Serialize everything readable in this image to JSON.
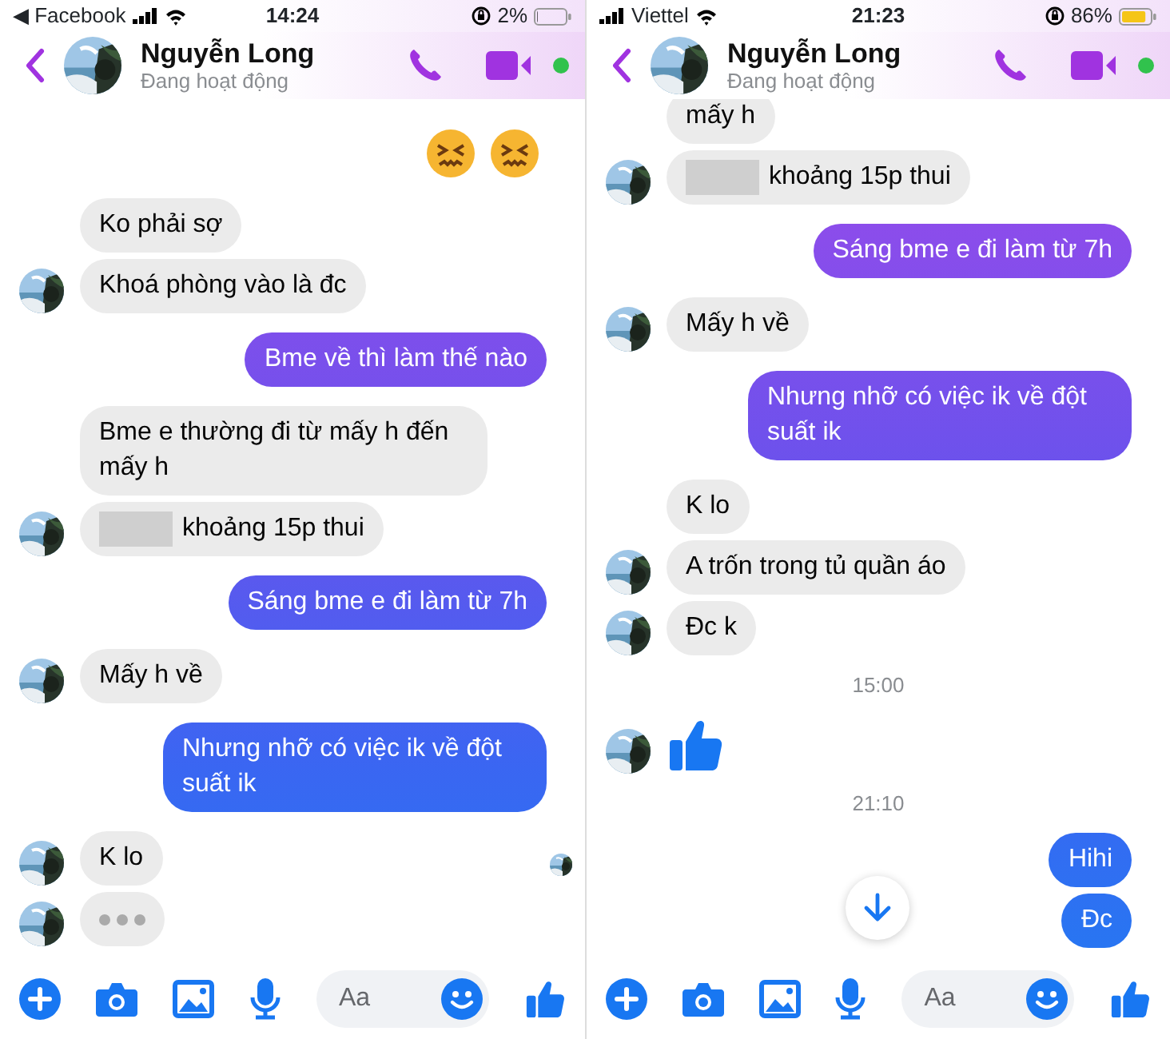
{
  "screens": [
    {
      "status_bar": {
        "back_link": "◀ Facebook",
        "time": "14:24",
        "battery": "2%",
        "low_power_mode": false
      },
      "header": {
        "name": "Nguyễn Long",
        "status": "Đang hoạt động",
        "online": true
      },
      "messages": [
        {
          "kind": "emojis"
        },
        {
          "kind": "received",
          "text": "Ko phải sợ",
          "avatar": false
        },
        {
          "kind": "received",
          "text": "Khoá phòng vào là đc",
          "avatar": true
        },
        {
          "kind": "sent",
          "text": "Bme về thì làm thế nào"
        },
        {
          "kind": "received",
          "text": "Bme e thường đi từ mấy h đến mấy h",
          "avatar": false
        },
        {
          "kind": "received",
          "text": "khoảng 15p thui",
          "avatar": true,
          "redacted": true
        },
        {
          "kind": "sent",
          "text": "Sáng bme e đi làm từ 7h"
        },
        {
          "kind": "received",
          "text": "Mấy h về",
          "avatar": true
        },
        {
          "kind": "sent",
          "text": "Nhưng nhỡ có việc ik về đột suất ik"
        },
        {
          "kind": "received",
          "text": "K lo",
          "avatar": true,
          "seen": true
        },
        {
          "kind": "typing",
          "avatar": true
        }
      ],
      "composer": {
        "placeholder": "Aa"
      }
    },
    {
      "status_bar": {
        "carrier": "Viettel",
        "time": "21:23",
        "battery": "86%",
        "low_power_mode": true
      },
      "header": {
        "name": "Nguyễn Long",
        "status": "Đang hoạt động",
        "online": true
      },
      "messages": [
        {
          "kind": "received",
          "text": "mấy h",
          "avatar": false
        },
        {
          "kind": "received",
          "text": "khoảng 15p thui",
          "avatar": true,
          "redacted": true
        },
        {
          "kind": "sent",
          "text": "Sáng bme e đi làm từ 7h"
        },
        {
          "kind": "received",
          "text": "Mấy h về",
          "avatar": true
        },
        {
          "kind": "sent",
          "text": "Nhưng nhỡ có việc ik về đột suất ik"
        },
        {
          "kind": "received",
          "text": "K lo",
          "avatar": false
        },
        {
          "kind": "received",
          "text": "A trốn trong tủ quần áo",
          "avatar": true
        },
        {
          "kind": "received",
          "text": "Đc k",
          "avatar": true
        },
        {
          "kind": "time",
          "text": "15:00"
        },
        {
          "kind": "like",
          "avatar": true
        },
        {
          "kind": "time",
          "text": "21:10"
        },
        {
          "kind": "sent",
          "text": "Hihi"
        },
        {
          "kind": "sent",
          "text": "Đc"
        }
      ],
      "scroll_down_button": true,
      "composer": {
        "placeholder": "Aa"
      }
    }
  ]
}
